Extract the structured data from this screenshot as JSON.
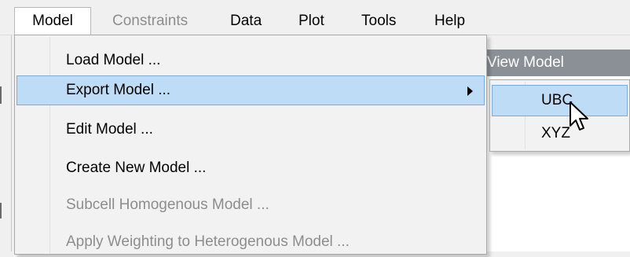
{
  "menubar": {
    "items": [
      {
        "label": "Model",
        "state": "open"
      },
      {
        "label": "Constraints",
        "state": "disabled"
      },
      {
        "label": "Data",
        "state": "normal"
      },
      {
        "label": "Plot",
        "state": "normal"
      },
      {
        "label": "Tools",
        "state": "normal"
      },
      {
        "label": "Help",
        "state": "normal"
      }
    ]
  },
  "background_window": {
    "title": "View Model"
  },
  "model_menu": {
    "items": [
      {
        "label": "Load Model ...",
        "enabled": true
      },
      {
        "label": "Export Model ...",
        "enabled": true,
        "highlighted": true,
        "has_submenu": true
      },
      {
        "label": "Edit Model ...",
        "enabled": true
      },
      {
        "label": "Create New Model ...",
        "enabled": true
      },
      {
        "label": "Subcell Homogenous Model ...",
        "enabled": false
      },
      {
        "label": "Apply Weighting to Heterogenous Model ...",
        "enabled": false
      }
    ]
  },
  "export_submenu": {
    "items": [
      {
        "label": "UBC",
        "highlighted": true
      },
      {
        "label": "XYZ",
        "highlighted": false
      }
    ]
  },
  "colors": {
    "highlight_fill": "#bfdcf6",
    "highlight_border": "#78acdc",
    "disabled_text": "#8d8d8d",
    "window_title_bar": "#8b9097"
  }
}
